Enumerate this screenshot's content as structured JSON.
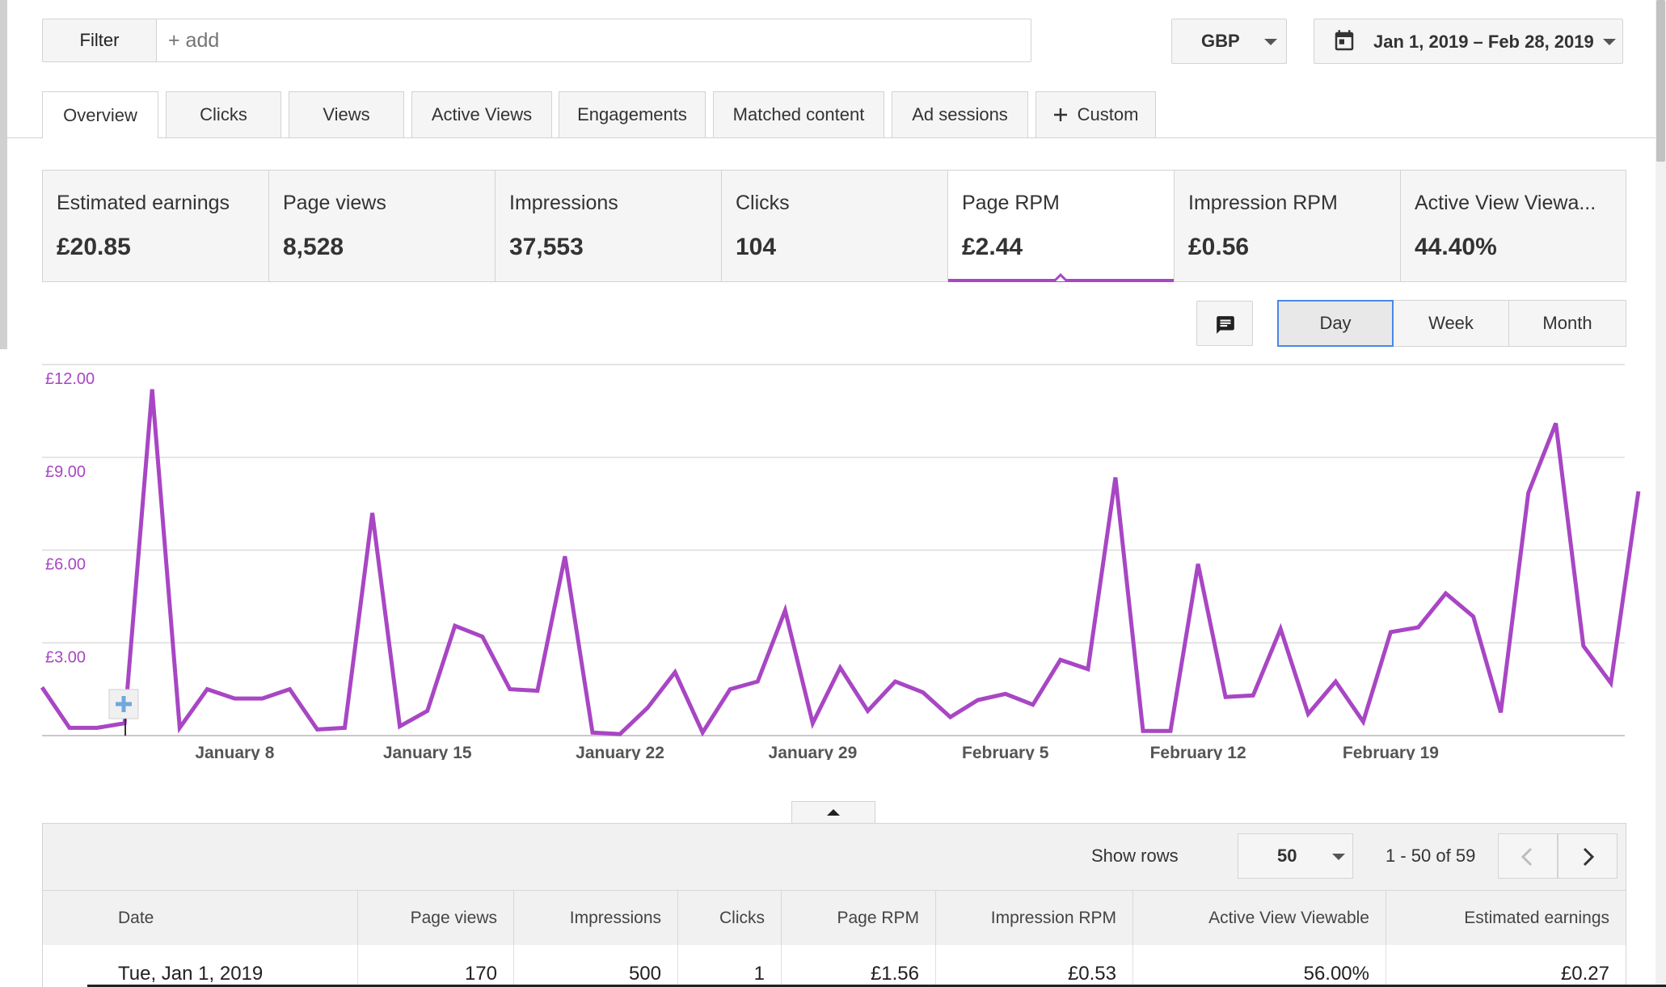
{
  "filter": {
    "label": "Filter",
    "placeholder": "+ add"
  },
  "currency": {
    "value": "GBP"
  },
  "date_range": {
    "value": "Jan 1, 2019 – Feb 28, 2019"
  },
  "tabs": [
    {
      "label": "Overview",
      "active": true
    },
    {
      "label": "Clicks"
    },
    {
      "label": "Views"
    },
    {
      "label": "Active Views"
    },
    {
      "label": "Engagements"
    },
    {
      "label": "Matched content"
    },
    {
      "label": "Ad sessions"
    },
    {
      "label": "Custom",
      "icon": "plus-icon"
    }
  ],
  "metrics": [
    {
      "label": "Estimated earnings",
      "value": "£20.85"
    },
    {
      "label": "Page views",
      "value": "8,528"
    },
    {
      "label": "Impressions",
      "value": "37,553"
    },
    {
      "label": "Clicks",
      "value": "104"
    },
    {
      "label": "Page RPM",
      "value": "£2.44",
      "selected": true
    },
    {
      "label": "Impression RPM",
      "value": "£0.56"
    },
    {
      "label": "Active View Viewa...",
      "value": "44.40%"
    }
  ],
  "granularity": {
    "options": [
      "Day",
      "Week",
      "Month"
    ],
    "selected": "Day"
  },
  "colors": {
    "series": "#a846c4",
    "axis_label": "#a846c4",
    "selected_border": "#4a86e8"
  },
  "chart_data": {
    "type": "line",
    "ylim": [
      0,
      12
    ],
    "yticks": [
      "£12.00",
      "£9.00",
      "£6.00",
      "£3.00"
    ],
    "ytick_values": [
      12,
      9,
      6,
      3
    ],
    "xticks": [
      {
        "label": "January 8",
        "day": 8
      },
      {
        "label": "January 15",
        "day": 15
      },
      {
        "label": "January 22",
        "day": 22
      },
      {
        "label": "January 29",
        "day": 29
      },
      {
        "label": "February 5",
        "day": 36
      },
      {
        "label": "February 12",
        "day": 43
      },
      {
        "label": "February 19",
        "day": 50
      }
    ],
    "x": [
      1,
      2,
      3,
      4,
      5,
      6,
      7,
      8,
      9,
      10,
      11,
      12,
      13,
      14,
      15,
      16,
      17,
      18,
      19,
      20,
      21,
      22,
      23,
      24,
      25,
      26,
      27,
      28,
      29,
      30,
      31,
      32,
      33,
      34,
      35,
      36,
      37,
      38,
      39,
      40,
      41,
      42,
      43,
      44,
      45,
      46,
      47,
      48,
      49,
      50,
      51,
      52,
      53,
      54,
      55,
      56,
      57,
      58,
      59
    ],
    "series": [
      {
        "values": [
          1.56,
          0.25,
          0.25,
          0.4,
          11.2,
          0.25,
          1.5,
          1.2,
          1.2,
          1.5,
          0.2,
          0.25,
          7.2,
          0.3,
          0.8,
          3.55,
          3.2,
          1.5,
          1.45,
          5.8,
          0.1,
          0.05,
          0.9,
          2.05,
          0.1,
          1.5,
          1.75,
          4.05,
          0.4,
          2.2,
          0.8,
          1.75,
          1.4,
          0.6,
          1.15,
          1.35,
          1.0,
          2.45,
          2.15,
          8.35,
          0.15,
          0.15,
          5.55,
          1.25,
          1.3,
          3.45,
          0.7,
          1.75,
          0.45,
          3.35,
          3.5,
          4.6,
          3.85,
          0.75,
          7.85,
          10.1,
          2.9,
          1.7,
          7.9
        ]
      }
    ]
  },
  "table": {
    "show_rows_label": "Show rows",
    "rows_value": "50",
    "range_label": "1 - 50 of 59",
    "columns": [
      "Date",
      "Page views",
      "Impressions",
      "Clicks",
      "Page RPM",
      "Impression RPM",
      "Active View Viewable",
      "Estimated earnings"
    ],
    "rows": [
      [
        "Tue, Jan 1, 2019",
        "170",
        "500",
        "1",
        "£1.56",
        "£0.53",
        "56.00%",
        "£0.27"
      ]
    ]
  }
}
